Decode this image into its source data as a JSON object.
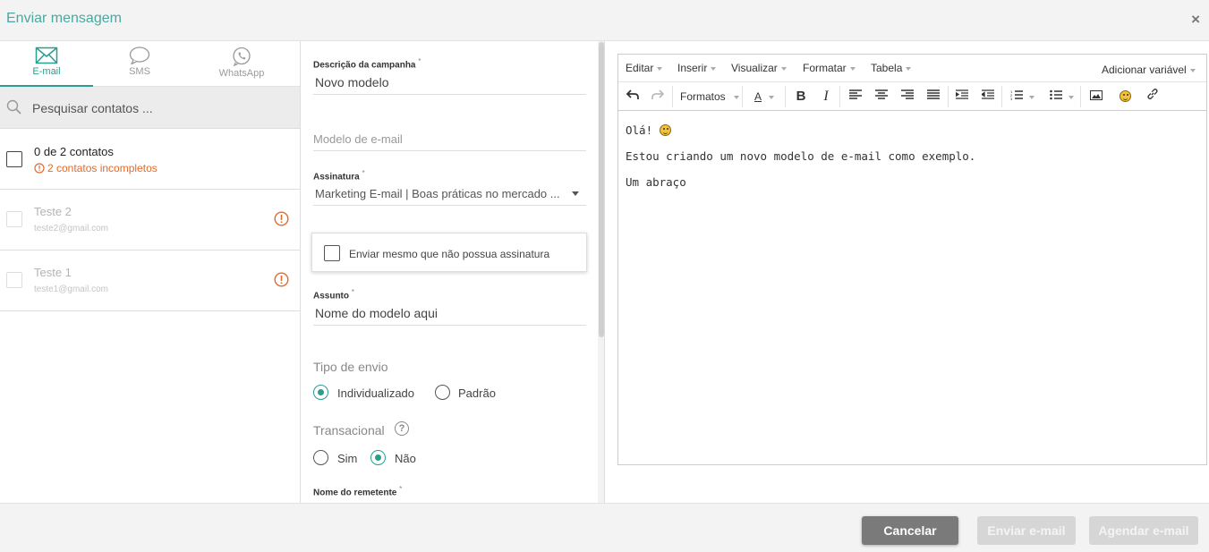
{
  "header": {
    "title": "Enviar mensagem",
    "close_label": "×"
  },
  "tabs": [
    {
      "label": "E-mail",
      "icon": "envelope-icon",
      "active": true
    },
    {
      "label": "SMS",
      "icon": "chat-bubble-icon",
      "active": false
    },
    {
      "label": "WhatsApp",
      "icon": "whatsapp-icon",
      "active": false
    }
  ],
  "search": {
    "placeholder": "Pesquisar contatos ..."
  },
  "contacts_summary": {
    "count_text": "0 de 2 contatos",
    "warning_text": "2 contatos incompletos"
  },
  "contacts": [
    {
      "name": "Teste 2",
      "email": "teste2@gmail.com"
    },
    {
      "name": "Teste 1",
      "email": "teste1@gmail.com"
    }
  ],
  "form": {
    "campaign_label": "Descrição da campanha",
    "campaign_value": "Novo modelo",
    "template_placeholder": "Modelo de e-mail",
    "signature_label": "Assinatura",
    "signature_value": "Marketing E-mail | Boas práticas no mercado ...",
    "send_without_signature": "Enviar mesmo que não possua assinatura",
    "subject_label": "Assunto",
    "subject_value": "Nome do modelo aqui",
    "send_type_label": "Tipo de envio",
    "send_type_options": [
      "Individualizado",
      "Padrão"
    ],
    "send_type_selected": "Individualizado",
    "transactional_label": "Transacional",
    "transactional_options": [
      "Sim",
      "Não"
    ],
    "transactional_selected": "Não",
    "sender_name_label": "Nome do remetente",
    "required_mark": "*"
  },
  "editor": {
    "menus": [
      "Editar",
      "Inserir",
      "Visualizar",
      "Formatar",
      "Tabela"
    ],
    "add_variable": "Adicionar variável",
    "formats_label": "Formatos",
    "content": {
      "line1": "Olá!",
      "line2": "Estou criando um novo modelo de e-mail como exemplo.",
      "line3": "Um abraço"
    }
  },
  "footer": {
    "cancel": "Cancelar",
    "send": "Enviar e-mail",
    "schedule": "Agendar e-mail"
  },
  "colors": {
    "accent": "#2a9d8f",
    "warning": "#e06b2c",
    "cancel_button": "#7a7a7a",
    "disabled_button": "#d6d6d6"
  }
}
